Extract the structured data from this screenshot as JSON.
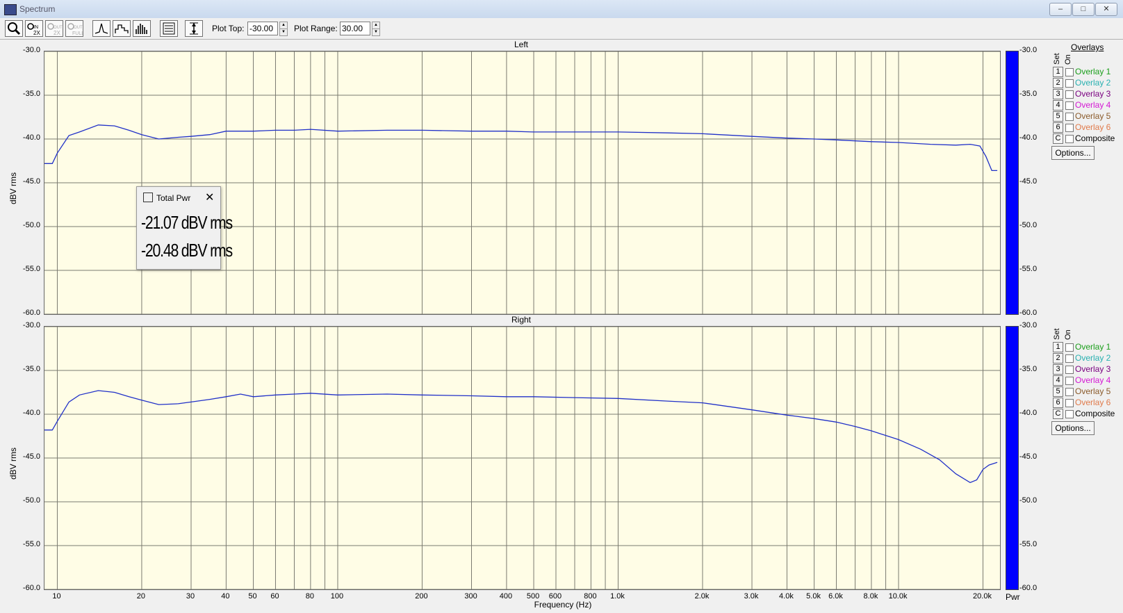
{
  "window": {
    "title": "Spectrum",
    "controls": [
      "–",
      "□",
      "✕"
    ]
  },
  "toolbar": {
    "plot_top_label": "Plot Top:",
    "plot_top_value": "-30.00",
    "plot_range_label": "Plot Range:",
    "plot_range_value": "30.00",
    "buttons": [
      "zoom-icon",
      "zoom-in-2x-icon",
      "zoom-out-2x-icon",
      "zoom-out-full-icon",
      "peak-mode-icon",
      "step-mode-icon",
      "bar-mode-icon",
      "settings-icon",
      "autoscale-icon"
    ]
  },
  "panels": [
    {
      "title": "Left",
      "ylabel": "dBV rms",
      "y_ticks": [
        "-30.0",
        "-35.0",
        "-40.0",
        "-45.0",
        "-50.0",
        "-55.0",
        "-60.0"
      ],
      "right_ticks": [
        "-30.0",
        "-35.0",
        "-40.0",
        "-45.0",
        "-50.0",
        "-55.0",
        "-60.0"
      ]
    },
    {
      "title": "Right",
      "ylabel": "dBV rms",
      "y_ticks": [
        "-30.0",
        "-35.0",
        "-40.0",
        "-45.0",
        "-50.0",
        "-55.0",
        "-60.0"
      ],
      "right_ticks": [
        "-30.0",
        "-35.0",
        "-40.0",
        "-45.0",
        "-50.0",
        "-55.0",
        "-60.0"
      ]
    }
  ],
  "overlays": {
    "header": "Overlays",
    "set_label": "Set",
    "on_label": "On",
    "items": [
      {
        "set": "1",
        "name": "Overlay 1",
        "color": "#1a9e1a"
      },
      {
        "set": "2",
        "name": "Overlay 2",
        "color": "#27b0b0"
      },
      {
        "set": "3",
        "name": "Overlay 3",
        "color": "#7a0080"
      },
      {
        "set": "4",
        "name": "Overlay 4",
        "color": "#d417d4"
      },
      {
        "set": "5",
        "name": "Overlay 5",
        "color": "#8a5a2a"
      },
      {
        "set": "6",
        "name": "Overlay 6",
        "color": "#e07a4a"
      },
      {
        "set": "C",
        "name": "Composite",
        "color": "#000000"
      }
    ],
    "options_label": "Options..."
  },
  "x_axis": {
    "label": "Frequency (Hz)",
    "ticks": [
      "10",
      "20",
      "30",
      "40",
      "50",
      "60",
      "80",
      "100",
      "200",
      "300",
      "400",
      "500",
      "600",
      "800",
      "1.0k",
      "2.0k",
      "3.0k",
      "4.0k",
      "5.0k",
      "6.0k",
      "8.0k",
      "10.0k",
      "20.0k"
    ]
  },
  "pwr_label": "Pwr",
  "total_power": {
    "title": "Total Pwr",
    "values": [
      "-21.07 dBV rms",
      "-20.48 dBV rms"
    ]
  },
  "chart_data": [
    {
      "type": "line",
      "title": "Left",
      "xlabel": "Frequency (Hz)",
      "ylabel": "dBV rms",
      "x_scale": "log",
      "xlim": [
        9,
        23000
      ],
      "ylim": [
        -60,
        -30
      ],
      "grid": true,
      "series": [
        {
          "color": "#2030c8",
          "x": [
            9,
            9.6,
            10,
            11,
            12,
            14,
            16,
            18,
            20,
            23,
            27,
            30,
            35,
            40,
            50,
            60,
            70,
            80,
            100,
            150,
            200,
            300,
            400,
            500,
            700,
            1000,
            1500,
            2000,
            3000,
            4000,
            5000,
            6000,
            8000,
            10000,
            13000,
            16000,
            18000,
            19500,
            20500,
            21500,
            22500
          ],
          "y": [
            -42.8,
            -42.8,
            -41.6,
            -39.6,
            -39.2,
            -38.4,
            -38.5,
            -39.0,
            -39.5,
            -40.0,
            -39.8,
            -39.7,
            -39.5,
            -39.1,
            -39.1,
            -39.0,
            -39.0,
            -38.9,
            -39.1,
            -39.0,
            -39.0,
            -39.1,
            -39.1,
            -39.2,
            -39.2,
            -39.2,
            -39.3,
            -39.4,
            -39.7,
            -39.9,
            -40.0,
            -40.1,
            -40.3,
            -40.4,
            -40.6,
            -40.7,
            -40.6,
            -40.8,
            -42.0,
            -43.6,
            -43.6
          ]
        }
      ]
    },
    {
      "type": "line",
      "title": "Right",
      "xlabel": "Frequency (Hz)",
      "ylabel": "dBV rms",
      "x_scale": "log",
      "xlim": [
        9,
        23000
      ],
      "ylim": [
        -60,
        -30
      ],
      "grid": true,
      "series": [
        {
          "color": "#2030c8",
          "x": [
            9,
            9.6,
            10,
            11,
            12,
            14,
            16,
            18,
            20,
            23,
            27,
            30,
            35,
            40,
            45,
            50,
            60,
            70,
            80,
            100,
            150,
            200,
            300,
            400,
            500,
            700,
            1000,
            1500,
            2000,
            3000,
            4000,
            5000,
            6000,
            7000,
            8000,
            10000,
            12000,
            14000,
            16000,
            18000,
            19000,
            20000,
            21000,
            22500
          ],
          "y": [
            -41.8,
            -41.8,
            -40.8,
            -38.6,
            -37.8,
            -37.3,
            -37.5,
            -38.0,
            -38.4,
            -38.9,
            -38.8,
            -38.6,
            -38.3,
            -38.0,
            -37.7,
            -38.0,
            -37.8,
            -37.7,
            -37.6,
            -37.8,
            -37.7,
            -37.8,
            -37.9,
            -38.0,
            -38.0,
            -38.1,
            -38.2,
            -38.5,
            -38.7,
            -39.5,
            -40.1,
            -40.5,
            -40.9,
            -41.4,
            -41.9,
            -42.9,
            -44.0,
            -45.2,
            -46.8,
            -47.8,
            -47.5,
            -46.3,
            -45.8,
            -45.5
          ]
        }
      ]
    }
  ]
}
